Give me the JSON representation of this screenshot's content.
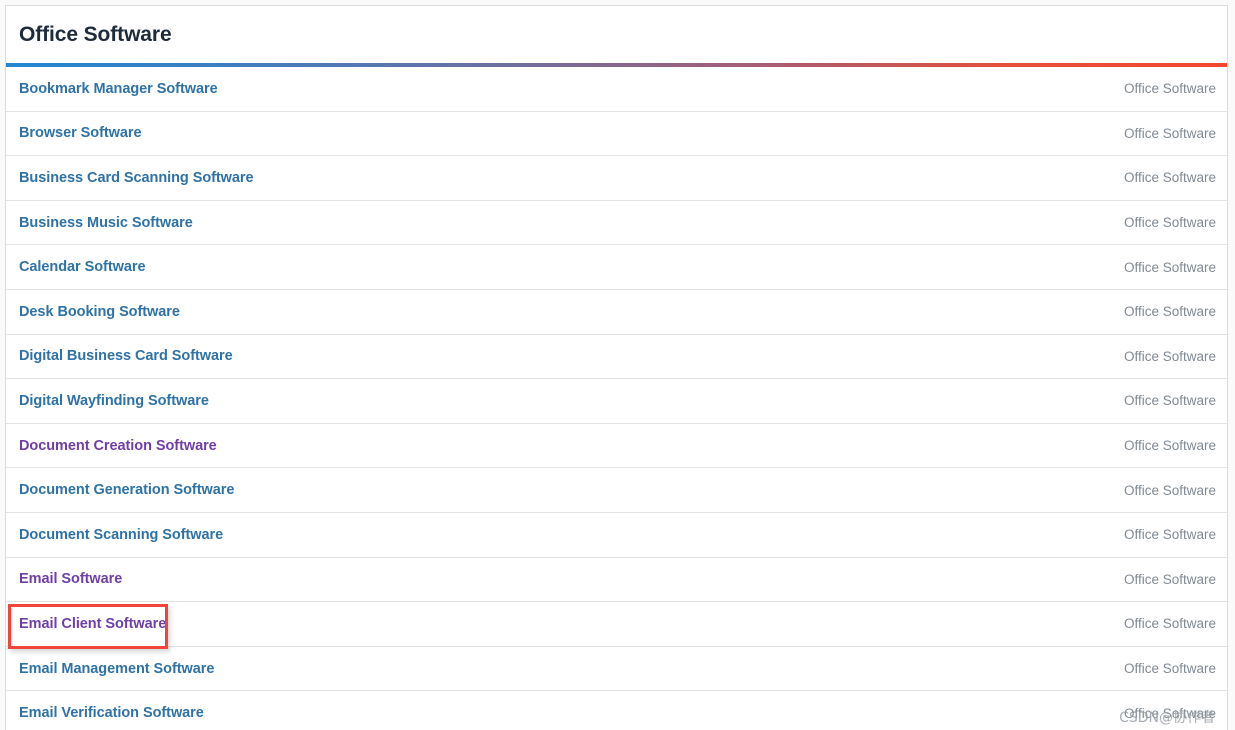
{
  "panel": {
    "title": "Office Software",
    "accent": {
      "from_color": "#2288d4",
      "to_color": "#f4482d"
    }
  },
  "list": {
    "category_label": "Office Software",
    "rows": [
      {
        "label": "Bookmark Manager Software",
        "meta": "Office Software",
        "visited": false
      },
      {
        "label": "Browser Software",
        "meta": "Office Software",
        "visited": false
      },
      {
        "label": "Business Card Scanning Software",
        "meta": "Office Software",
        "visited": false
      },
      {
        "label": "Business Music Software",
        "meta": "Office Software",
        "visited": false
      },
      {
        "label": "Calendar Software",
        "meta": "Office Software",
        "visited": false
      },
      {
        "label": "Desk Booking Software",
        "meta": "Office Software",
        "visited": false
      },
      {
        "label": "Digital Business Card Software",
        "meta": "Office Software",
        "visited": false
      },
      {
        "label": "Digital Wayfinding Software",
        "meta": "Office Software",
        "visited": false
      },
      {
        "label": "Document Creation Software",
        "meta": "Office Software",
        "visited": true
      },
      {
        "label": "Document Generation Software",
        "meta": "Office Software",
        "visited": false
      },
      {
        "label": "Document Scanning Software",
        "meta": "Office Software",
        "visited": false
      },
      {
        "label": "Email Software",
        "meta": "Office Software",
        "visited": true
      },
      {
        "label": "Email Client Software",
        "meta": "Office Software",
        "visited": true
      },
      {
        "label": "Email Management Software",
        "meta": "Office Software",
        "visited": false
      },
      {
        "label": "Email Verification Software",
        "meta": "Office Software",
        "visited": false
      }
    ]
  },
  "annotation": {
    "highlight_color": "#f0453a",
    "target_label": "Email Client Software"
  },
  "watermark": {
    "text": "CSDN@协作者"
  }
}
